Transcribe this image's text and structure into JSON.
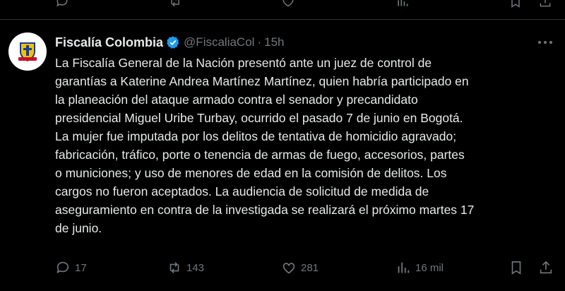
{
  "tweet": {
    "author_name": "Fiscalía Colombia",
    "handle": "@FiscaliaCol",
    "separator": "·",
    "time": "15h",
    "avatar_caption": "FISCALÍA",
    "text": "La Fiscalía General de la Nación presentó ante un juez de control de\ngarantías a Katerine Andrea Martínez Martínez, quien habría participado en\nla planeación del ataque armado contra el senador y precandidato\npresidencial Miguel Uribe Turbay, ocurrido el pasado 7 de junio en Bogotá.\nLa mujer fue imputada por los delitos de tentativa de homicidio agravado;\nfabricación, tráfico, porte o tenencia de armas de fuego, accesorios, partes\no municiones; y uso de menores de edad en la comisión de delitos. Los\ncargos no fueron aceptados. La audiencia de solicitud de medida de\naseguramiento en contra de la investigada se realizará el próximo martes 17\nde junio.",
    "actions": {
      "replies": "17",
      "reposts": "143",
      "likes": "281",
      "views": "16 mil"
    }
  },
  "colors": {
    "background": "#000000",
    "text": "#e7e9ea",
    "muted": "#71767b",
    "verified": "#1d9bf0",
    "divider": "#2f3336"
  }
}
